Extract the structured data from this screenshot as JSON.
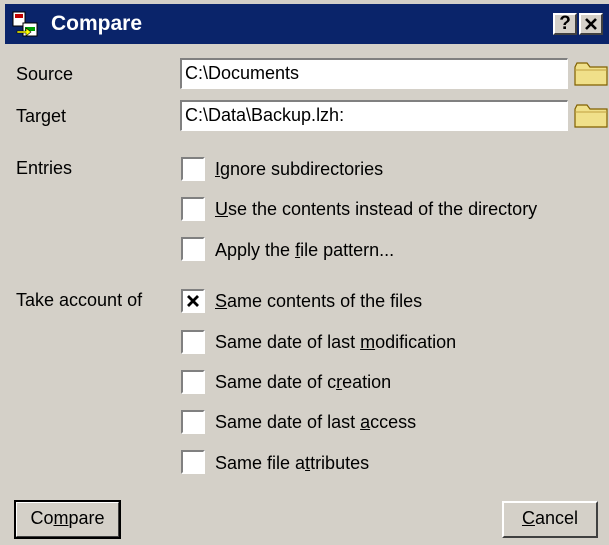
{
  "window": {
    "title": "Compare",
    "help_btn": "?",
    "close_btn": "✕"
  },
  "source": {
    "label": "Source",
    "value": "C:\\Documents"
  },
  "target": {
    "label": "Target",
    "value": "C:\\Data\\Backup.lzh:"
  },
  "entries": {
    "label": "Entries",
    "options": [
      {
        "pre": "",
        "key": "I",
        "post": "gnore subdirectories",
        "checked": false
      },
      {
        "pre": "",
        "key": "U",
        "post": "se the contents instead of the directory",
        "checked": false
      },
      {
        "pre": "Apply the ",
        "key": "f",
        "post": "ile pattern...",
        "checked": false
      }
    ]
  },
  "account": {
    "label": "Take account of",
    "options": [
      {
        "pre": "",
        "key": "S",
        "post": "ame contents of the files",
        "checked": true
      },
      {
        "pre": "Same date of last ",
        "key": "m",
        "post": "odification",
        "checked": false
      },
      {
        "pre": "Same date of c",
        "key": "r",
        "post": "eation",
        "checked": false
      },
      {
        "pre": "Same date of last ",
        "key": "a",
        "post": "ccess",
        "checked": false
      },
      {
        "pre": "Same file a",
        "key": "t",
        "post": "tributes",
        "checked": false
      }
    ]
  },
  "buttons": {
    "compare": {
      "pre": "Co",
      "key": "m",
      "post": "pare"
    },
    "cancel": {
      "pre": "",
      "key": "C",
      "post": "ancel"
    }
  },
  "icons": {
    "app": "compare-app-icon",
    "folder": "folder-icon",
    "check": "check-mark-icon"
  },
  "colors": {
    "titlebar": "#0a246a",
    "face": "#d4d0c8",
    "folder": "#f0e08a"
  }
}
